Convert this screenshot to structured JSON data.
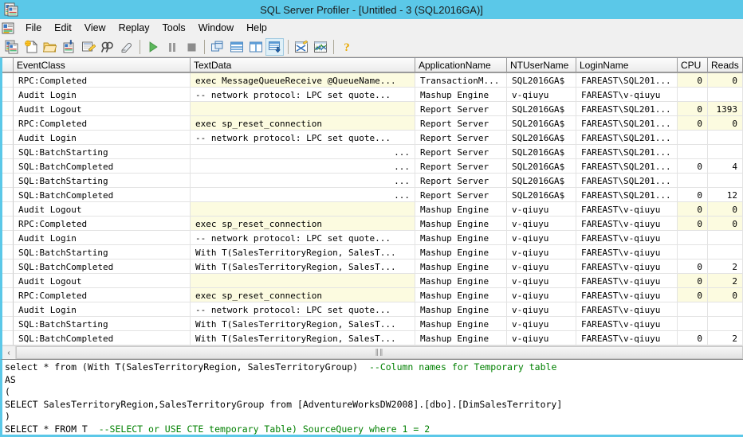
{
  "window": {
    "title": "SQL Server Profiler - [Untitled - 3 (SQL2016GA)]",
    "app_icon": "profiler-icon",
    "accent_color": "#5bc8e8"
  },
  "menu": {
    "icon": "profiler-window-icon",
    "items": [
      {
        "label": "File"
      },
      {
        "label": "Edit"
      },
      {
        "label": "View"
      },
      {
        "label": "Replay"
      },
      {
        "label": "Tools"
      },
      {
        "label": "Window"
      },
      {
        "label": "Help"
      }
    ]
  },
  "toolbar": {
    "buttons": [
      {
        "name": "new-trace-icon",
        "title": "New Trace"
      },
      {
        "name": "trace-template-icon",
        "title": "New Template"
      },
      {
        "name": "open-trace-file-icon",
        "title": "Open Trace File"
      },
      {
        "name": "save-trace-icon",
        "title": "Save"
      },
      {
        "name": "trace-properties-icon",
        "title": "Properties"
      },
      {
        "name": "find-icon",
        "title": "Find"
      },
      {
        "name": "clear-trace-icon",
        "title": "Clear Trace Window"
      },
      {
        "name": "separator-1",
        "title": ""
      },
      {
        "name": "start-trace-icon",
        "title": "Start Selected Trace"
      },
      {
        "name": "pause-trace-icon",
        "title": "Pause Selected Trace"
      },
      {
        "name": "stop-trace-icon",
        "title": "Stop Selected Trace"
      },
      {
        "name": "separator-2",
        "title": ""
      },
      {
        "name": "auto-scroll-icon",
        "title": "Auto Scroll Window"
      },
      {
        "name": "group-single-icon",
        "title": "Grouped View"
      },
      {
        "name": "group-split-icon",
        "title": "Aggregated View"
      },
      {
        "name": "show-aggregated-icon",
        "title": "Show Aggregated View"
      },
      {
        "name": "separator-3",
        "title": ""
      },
      {
        "name": "query-analyzer-icon",
        "title": "Query Analyzer"
      },
      {
        "name": "performance-log-icon",
        "title": "Import Performance Data"
      },
      {
        "name": "separator-4",
        "title": ""
      },
      {
        "name": "help-icon",
        "title": "Help"
      }
    ]
  },
  "grid": {
    "columns": [
      {
        "key": "selector",
        "label": ""
      },
      {
        "key": "EventClass",
        "label": "EventClass"
      },
      {
        "key": "TextData",
        "label": "TextData"
      },
      {
        "key": "ApplicationName",
        "label": "ApplicationName"
      },
      {
        "key": "NTUserName",
        "label": "NTUserName"
      },
      {
        "key": "LoginName",
        "label": "LoginName"
      },
      {
        "key": "CPU",
        "label": "CPU"
      },
      {
        "key": "Reads",
        "label": "Reads"
      }
    ],
    "highlight_color": "#fcfbe0",
    "rows": [
      {
        "EventClass": "RPC:Completed",
        "TextData": "exec MessageQueueReceive @QueueName...",
        "TextDataAlign": "left",
        "ApplicationName": "TransactionM...",
        "NTUserName": "SQL2016GA$",
        "LoginName": "FAREAST\\SQL201...",
        "CPU": "0",
        "Reads": "0",
        "highlight": true
      },
      {
        "EventClass": "Audit Login",
        "TextData": "-- network protocol: LPC  set quote...",
        "TextDataAlign": "left",
        "ApplicationName": "Mashup Engine",
        "NTUserName": "v-qiuyu",
        "LoginName": "FAREAST\\v-qiuyu",
        "CPU": "",
        "Reads": "",
        "highlight": false
      },
      {
        "EventClass": "Audit Logout",
        "TextData": "",
        "TextDataAlign": "left",
        "ApplicationName": "Report Server",
        "NTUserName": "SQL2016GA$",
        "LoginName": "FAREAST\\SQL201...",
        "CPU": "0",
        "Reads": "1393",
        "highlight": true
      },
      {
        "EventClass": "RPC:Completed",
        "TextData": "exec sp_reset_connection",
        "TextDataAlign": "left",
        "ApplicationName": "Report Server",
        "NTUserName": "SQL2016GA$",
        "LoginName": "FAREAST\\SQL201...",
        "CPU": "0",
        "Reads": "0",
        "highlight": true
      },
      {
        "EventClass": "Audit Login",
        "TextData": "-- network protocol: LPC  set quote...",
        "TextDataAlign": "left",
        "ApplicationName": "Report Server",
        "NTUserName": "SQL2016GA$",
        "LoginName": "FAREAST\\SQL201...",
        "CPU": "",
        "Reads": "",
        "highlight": false
      },
      {
        "EventClass": "SQL:BatchStarting",
        "TextData": "...",
        "TextDataAlign": "right",
        "ApplicationName": "Report Server",
        "NTUserName": "SQL2016GA$",
        "LoginName": "FAREAST\\SQL201...",
        "CPU": "",
        "Reads": "",
        "highlight": false
      },
      {
        "EventClass": "SQL:BatchCompleted",
        "TextData": "...",
        "TextDataAlign": "right",
        "ApplicationName": "Report Server",
        "NTUserName": "SQL2016GA$",
        "LoginName": "FAREAST\\SQL201...",
        "CPU": "0",
        "Reads": "4",
        "highlight": false
      },
      {
        "EventClass": "SQL:BatchStarting",
        "TextData": "...",
        "TextDataAlign": "right",
        "ApplicationName": "Report Server",
        "NTUserName": "SQL2016GA$",
        "LoginName": "FAREAST\\SQL201...",
        "CPU": "",
        "Reads": "",
        "highlight": false
      },
      {
        "EventClass": "SQL:BatchCompleted",
        "TextData": "...",
        "TextDataAlign": "right",
        "ApplicationName": "Report Server",
        "NTUserName": "SQL2016GA$",
        "LoginName": "FAREAST\\SQL201...",
        "CPU": "0",
        "Reads": "12",
        "highlight": false
      },
      {
        "EventClass": "Audit Logout",
        "TextData": "",
        "TextDataAlign": "left",
        "ApplicationName": "Mashup Engine",
        "NTUserName": "v-qiuyu",
        "LoginName": "FAREAST\\v-qiuyu",
        "CPU": "0",
        "Reads": "0",
        "highlight": true
      },
      {
        "EventClass": "RPC:Completed",
        "TextData": "exec sp_reset_connection",
        "TextDataAlign": "left",
        "ApplicationName": "Mashup Engine",
        "NTUserName": "v-qiuyu",
        "LoginName": "FAREAST\\v-qiuyu",
        "CPU": "0",
        "Reads": "0",
        "highlight": true
      },
      {
        "EventClass": "Audit Login",
        "TextData": "-- network protocol: LPC  set quote...",
        "TextDataAlign": "left",
        "ApplicationName": "Mashup Engine",
        "NTUserName": "v-qiuyu",
        "LoginName": "FAREAST\\v-qiuyu",
        "CPU": "",
        "Reads": "",
        "highlight": false
      },
      {
        "EventClass": "SQL:BatchStarting",
        "TextData": "With T(SalesTerritoryRegion, SalesT...",
        "TextDataAlign": "left",
        "ApplicationName": "Mashup Engine",
        "NTUserName": "v-qiuyu",
        "LoginName": "FAREAST\\v-qiuyu",
        "CPU": "",
        "Reads": "",
        "highlight": false
      },
      {
        "EventClass": "SQL:BatchCompleted",
        "TextData": "With T(SalesTerritoryRegion, SalesT...",
        "TextDataAlign": "left",
        "ApplicationName": "Mashup Engine",
        "NTUserName": "v-qiuyu",
        "LoginName": "FAREAST\\v-qiuyu",
        "CPU": "0",
        "Reads": "2",
        "highlight": false
      },
      {
        "EventClass": "Audit Logout",
        "TextData": "",
        "TextDataAlign": "left",
        "ApplicationName": "Mashup Engine",
        "NTUserName": "v-qiuyu",
        "LoginName": "FAREAST\\v-qiuyu",
        "CPU": "0",
        "Reads": "2",
        "highlight": true
      },
      {
        "EventClass": "RPC:Completed",
        "TextData": "exec sp_reset_connection",
        "TextDataAlign": "left",
        "ApplicationName": "Mashup Engine",
        "NTUserName": "v-qiuyu",
        "LoginName": "FAREAST\\v-qiuyu",
        "CPU": "0",
        "Reads": "0",
        "highlight": true
      },
      {
        "EventClass": "Audit Login",
        "TextData": "-- network protocol: LPC  set quote...",
        "TextDataAlign": "left",
        "ApplicationName": "Mashup Engine",
        "NTUserName": "v-qiuyu",
        "LoginName": "FAREAST\\v-qiuyu",
        "CPU": "",
        "Reads": "",
        "highlight": false
      },
      {
        "EventClass": "SQL:BatchStarting",
        "TextData": "With T(SalesTerritoryRegion, SalesT...",
        "TextDataAlign": "left",
        "ApplicationName": "Mashup Engine",
        "NTUserName": "v-qiuyu",
        "LoginName": "FAREAST\\v-qiuyu",
        "CPU": "",
        "Reads": "",
        "highlight": false
      },
      {
        "EventClass": "SQL:BatchCompleted",
        "TextData": "With T(SalesTerritoryRegion, SalesT...",
        "TextDataAlign": "left",
        "ApplicationName": "Mashup Engine",
        "NTUserName": "v-qiuyu",
        "LoginName": "FAREAST\\v-qiuyu",
        "CPU": "0",
        "Reads": "2",
        "highlight": false
      }
    ]
  },
  "hscroll": {
    "left_arrow": "‹",
    "grip": "‖‖"
  },
  "sql_pane": {
    "lines": [
      "select * from (With T(SalesTerritoryRegion, SalesTerritoryGroup)  --Column names for Temporary table",
      "AS",
      "(",
      "SELECT SalesTerritoryRegion,SalesTerritoryGroup from [AdventureWorksDW2008].[dbo].[DimSalesTerritory]",
      "",
      ")",
      "SELECT * FROM T  --SELECT or USE CTE temporary Table) SourceQuery where 1 = 2"
    ]
  }
}
